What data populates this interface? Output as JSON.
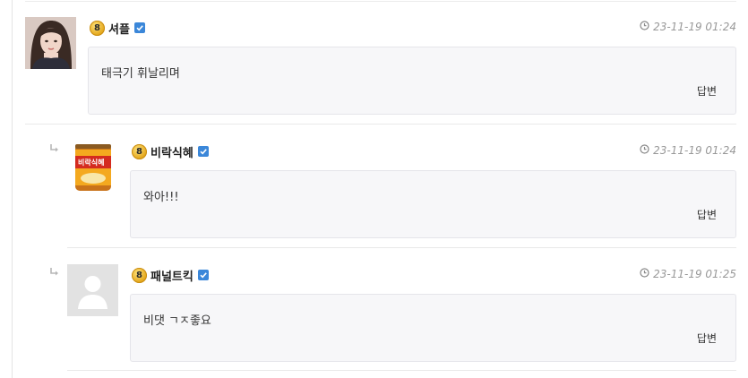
{
  "comments": [
    {
      "nickname": "셔플",
      "level": "8",
      "date": "23-11-19 01:24",
      "text": "태극기 휘날리며",
      "reply_label": "답변",
      "is_reply": false
    },
    {
      "nickname": "비락식혜",
      "level": "8",
      "date": "23-11-19 01:24",
      "text": "와아!!!",
      "reply_label": "답변",
      "is_reply": true,
      "avatar_text": "비락식혜"
    },
    {
      "nickname": "패널트킥",
      "level": "8",
      "date": "23-11-19 01:25",
      "text": "비댓 ㄱㅈ좋요",
      "reply_label": "답변",
      "is_reply": true
    }
  ],
  "icons": {
    "reply_arrow": "reply-arrow-icon",
    "verified": "verified-check-icon",
    "clock": "clock-icon",
    "level_badge": "level-badge-icon"
  },
  "colors": {
    "verified": "#3b87d9",
    "badge": "#e2a417",
    "box_bg": "#f7f7f9"
  }
}
